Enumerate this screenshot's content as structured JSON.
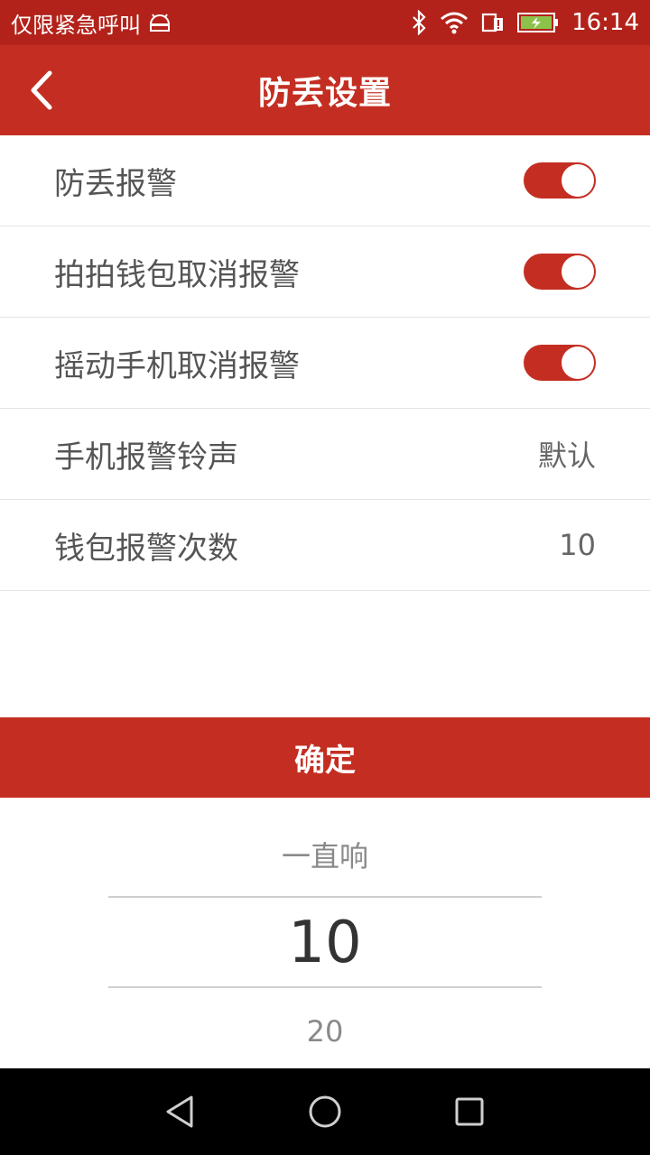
{
  "status_bar": {
    "carrier_text": "仅限紧急呼叫",
    "time": "16:14"
  },
  "header": {
    "title": "防丢设置",
    "back_icon": "chevron-left-icon"
  },
  "settings": [
    {
      "label": "防丢报警",
      "type": "toggle",
      "on": true
    },
    {
      "label": "拍拍钱包取消报警",
      "type": "toggle",
      "on": true
    },
    {
      "label": "摇动手机取消报警",
      "type": "toggle",
      "on": true
    },
    {
      "label": "手机报警铃声",
      "type": "value",
      "value": "默认"
    },
    {
      "label": "钱包报警次数",
      "type": "value",
      "value": "10"
    }
  ],
  "confirm_label": "确定",
  "picker": {
    "prev": "一直响",
    "selected": "10",
    "next": "20"
  },
  "colors": {
    "primary": "#c42e22",
    "status_bar": "#b3221a",
    "nav_bar": "#000000"
  }
}
